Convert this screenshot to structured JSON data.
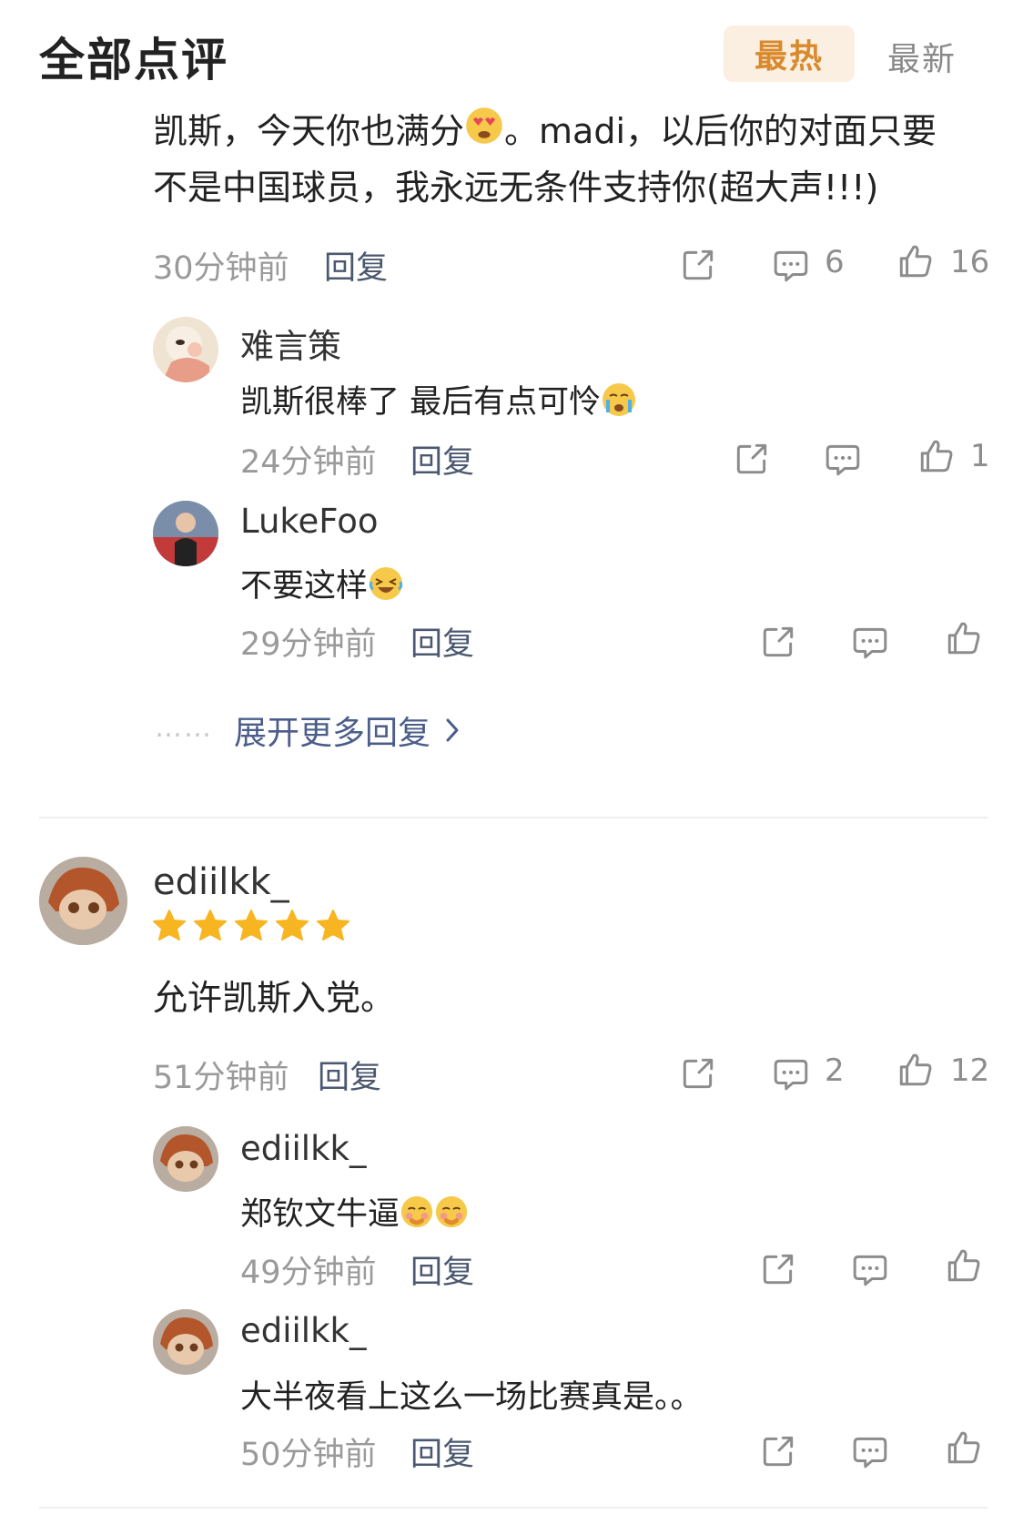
{
  "header": {
    "title": "全部点评",
    "tab_hot": "最热",
    "tab_new": "最新"
  },
  "comment1": {
    "line1_a": "凯斯，今天你也满分",
    "line1_b": "。madi，以后你的对面只要",
    "line2": "不是中国球员，我永远无条件支持你(超大声!!!)",
    "time": "30分钟前",
    "reply": "回复",
    "comments": "6",
    "likes": "16",
    "replies": [
      {
        "name": "难言策",
        "text": "凯斯很棒了 最后有点可怜",
        "time": "24分钟前",
        "reply": "回复",
        "likes": "1"
      },
      {
        "name": "LukeFoo",
        "text": "不要这样",
        "time": "29分钟前",
        "reply": "回复"
      }
    ],
    "expand": "展开更多回复",
    "dots": "……"
  },
  "comment2": {
    "name": "ediilkk_",
    "rating_stars": 5,
    "text": "允许凯斯入党。",
    "time": "51分钟前",
    "reply": "回复",
    "comments": "2",
    "likes": "12",
    "replies": [
      {
        "name": "ediilkk_",
        "text": "郑钦文牛逼",
        "time": "49分钟前",
        "reply": "回复"
      },
      {
        "name": "ediilkk_",
        "text": "大半夜看上这么一场比赛真是。。",
        "time": "50分钟前",
        "reply": "回复"
      }
    ]
  },
  "colors": {
    "accent_tab_bg": "#fbefe2",
    "accent_tab_text": "#d88a2c",
    "star": "#f7b521",
    "reply_link": "#4b5870"
  },
  "icons": [
    "share-icon",
    "comment-icon",
    "like-icon",
    "star-icon",
    "chevron-right-icon",
    "emoji-heart-eyes",
    "emoji-crying",
    "emoji-laughing-tears",
    "emoji-blush"
  ]
}
